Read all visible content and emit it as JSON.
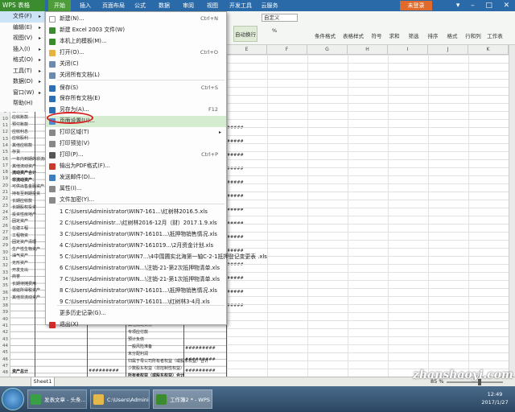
{
  "app": {
    "menu_label": "WPS 表格",
    "login": "未登录"
  },
  "ribbon_tabs": [
    "开始",
    "插入",
    "页面布局",
    "公式",
    "数据",
    "审阅",
    "视图",
    "开发工具",
    "云服务"
  ],
  "toolbar": {
    "font_name": "宋体",
    "font_size": "10",
    "format": "自定义",
    "wrap": "自动换行",
    "percent": "%",
    "btn_cond": "条件格式",
    "btn_table": "表格样式",
    "btn_sym": "符号",
    "btn_sum": "求和",
    "btn_filter": "筛选",
    "btn_sort": "排序",
    "btn_format": "格式",
    "btn_rowcol": "行和列",
    "btn_sheet": "工作表",
    "btn_freeze": "冻结"
  },
  "side_menu": [
    {
      "label": "文件(F)",
      "active": true
    },
    {
      "label": "编辑(E)"
    },
    {
      "label": "视图(V)"
    },
    {
      "label": "插入(I)"
    },
    {
      "label": "格式(O)"
    },
    {
      "label": "工具(T)"
    },
    {
      "label": "数据(D)"
    },
    {
      "label": "窗口(W)"
    },
    {
      "label": "帮助(H)"
    }
  ],
  "file_menu": [
    {
      "label": "新建(N)...",
      "shortcut": "Ctrl+N",
      "color": "#ffffff"
    },
    {
      "label": "新建 Excel 2003 文件(W)",
      "color": "#3b8c2f"
    },
    {
      "label": "本机上的模板(M)...",
      "color": "#3b8c2f"
    },
    {
      "label": "打开(O)...",
      "shortcut": "Ctrl+O",
      "color": "#e6b43a"
    },
    {
      "label": "关闭(C)",
      "color": "#6a8ab0"
    },
    {
      "label": "关闭所有文档(L)",
      "color": "#6a8ab0"
    },
    {
      "label": "保存(S)",
      "shortcut": "Ctrl+S",
      "color": "#2c6fb4"
    },
    {
      "label": "保存所有文档(E)",
      "color": "#2c6fb4"
    },
    {
      "label": "另存为(A)...",
      "shortcut": "F12",
      "color": "#2c6fb4"
    },
    {
      "label": "页面设置(U)...",
      "color": "#4f8ad0",
      "highlight": true
    },
    {
      "label": "打印区域(T)",
      "arrow": true,
      "color": "#888888"
    },
    {
      "label": "打印预览(V)",
      "color": "#888888"
    },
    {
      "label": "打印(P)...",
      "shortcut": "Ctrl+P",
      "color": "#555555"
    },
    {
      "label": "输出为PDF格式(F)...",
      "color": "#c83a2a"
    },
    {
      "label": "发送邮件(D)...",
      "color": "#3e7cc0"
    },
    {
      "label": "属性(I)...",
      "color": "#888888"
    },
    {
      "label": "文件加密(Y)...",
      "color": "#888888"
    },
    {
      "label": "1 C:\\Users\\Administrator\\WIN7-161...\\红树林2016.5.xls"
    },
    {
      "label": "2 C:\\Users\\Administr...\\红树林2016-12月（财）2017.1.9.xls"
    },
    {
      "label": "3 C:\\Users\\Administrator\\WIN7-16101...\\抵押物销售情况.xls"
    },
    {
      "label": "4 C:\\Users\\Administrator\\WIN7-161019...\\2月资金计划.xls"
    },
    {
      "label": "5 C:\\Users\\Administrator\\WIN7...\\4中围圃实北海第一轴C-2-1抵押登记变更表 .xls"
    },
    {
      "label": "6 C:\\Users\\Administrator\\WIN...\\注销-21-第2次抵押物清单.xls"
    },
    {
      "label": "7 C:\\Users\\Administrator\\WIN...\\注销-21-第1次抵押物清单.xls"
    },
    {
      "label": "8 C:\\Users\\Administrator\\WIN7-16101...\\抵押物销售情况.xls"
    },
    {
      "label": "9 C:\\Users\\Administrator\\WIN7-16101...\\红树林3-4月.xls"
    },
    {
      "label": "更多历史记录(G)..."
    },
    {
      "label": "退出(X)",
      "color": "#d02a2a"
    }
  ],
  "columns": [
    "A",
    "B",
    "C",
    "D",
    "E",
    "F",
    "G",
    "H",
    "I",
    "J",
    "K"
  ],
  "rows": [
    "1",
    "2",
    "3",
    "4",
    "5",
    "6",
    "7",
    "8",
    "9",
    "10",
    "11",
    "12",
    "13",
    "14",
    "15",
    "16",
    "17",
    "18",
    "19",
    "20",
    "21",
    "22",
    "23",
    "24",
    "25",
    "26",
    "27",
    "28",
    "29",
    "30",
    "31",
    "32",
    "33",
    "34",
    "35",
    "36",
    "37",
    "38",
    "39",
    "40",
    "41",
    "42",
    "43",
    "44",
    "45",
    "46",
    "47",
    "48"
  ],
  "cells": {
    "r1": "流动资产：",
    "r2": "货币资金",
    "r3": "交易性金融资产",
    "r4": "应收票据",
    "r5": "应收账款",
    "r6": "预付账款",
    "r7": "应收利息",
    "r8": "应收股利",
    "r9": "其他应收款",
    "r10": "存货",
    "r11": "一年内到期的非流动资产",
    "r12": "其他流动资产",
    "r13": "流动资产合计",
    "r14": "非流动资产：",
    "r15": "可供出售金融资产",
    "r16": "持有至到期投资",
    "r17": "长期应收款",
    "r18": "长期股权投资",
    "r19": "投资性房地产",
    "r20": "固定资产",
    "r21": "在建工程",
    "r22": "工程物资",
    "r23": "固定资产清理",
    "r24": "生产性生物资产",
    "r25": "油气资产",
    "r26": "无形资产",
    "r27": "开发支出",
    "r28": "商誉",
    "r29": "长期待摊费用",
    "r30": "递延所得税资产",
    "r31": "其他非流动资产",
    "mid1": "其他流动负债",
    "mid2": "专项应付款",
    "mid3": "预计负债",
    "mid4": "一般风险准备",
    "mid5": "未分配利润",
    "mid6": "归属于母公司所有者权益（或股东权益）合计",
    "mid7": "少数股东权益（非控制性权益）",
    "mid8": "所有者权益（或股东权益）合计",
    "mid9": "负债和所有者权益（或股东权益）总计",
    "total_assets": "非流动资产合计",
    "total": "资产总计",
    "hdr_unit": "：人民币元",
    "hdr_col": "上年金额",
    "hash": "#########"
  },
  "sheet_tab": "Sheet1",
  "zoom": "85 %",
  "taskbar": {
    "t1": "发表文章 - 头条...",
    "t2": "C:\\Users\\Admini...",
    "t3": "工作簿2 * - WPS ..."
  },
  "clock": {
    "time": "12:49",
    "date": "2017/1/27"
  },
  "watermark": "zhanshaoyi.com",
  "colors": {
    "accent": "#3b8c2f",
    "ribbon": "#2a6aa8",
    "highlight": "#d6ecd0",
    "circle": "#d81e1e"
  }
}
